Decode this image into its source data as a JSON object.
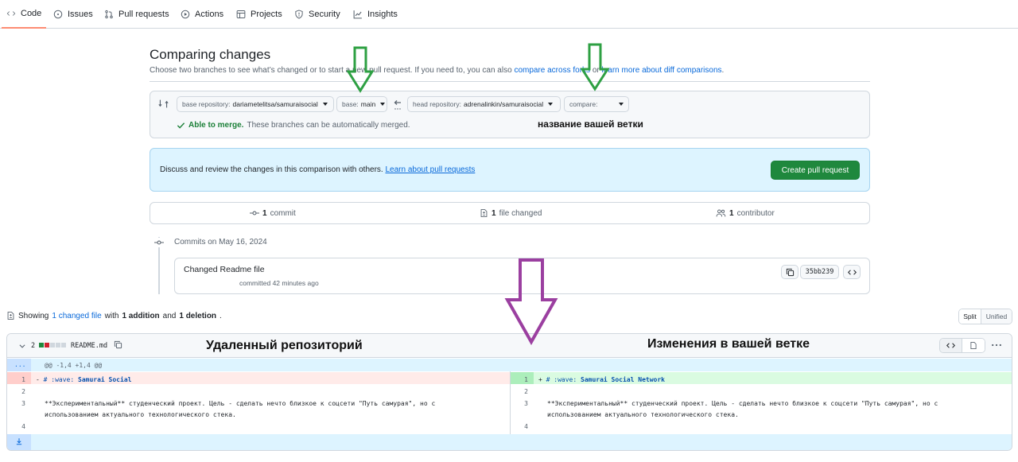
{
  "nav": {
    "tabs": [
      {
        "label": "Code",
        "icon": "code-icon"
      },
      {
        "label": "Issues",
        "icon": "issue-icon"
      },
      {
        "label": "Pull requests",
        "icon": "pull-request-icon"
      },
      {
        "label": "Actions",
        "icon": "play-icon"
      },
      {
        "label": "Projects",
        "icon": "table-icon"
      },
      {
        "label": "Security",
        "icon": "shield-icon"
      },
      {
        "label": "Insights",
        "icon": "graph-icon"
      }
    ]
  },
  "compare": {
    "title": "Comparing changes",
    "subtitle_pre": "Choose two branches to see what’s changed or to start a new pull request. If you need to, you can also",
    "subtitle_link1": "compare across forks",
    "subtitle_or": "or",
    "subtitle_link2": "learn more about diff comparisons",
    "subtitle_end": ".",
    "base_repo_label": "base repository:",
    "base_repo": "dariametelitsa/samuraisocial",
    "base_label": "base:",
    "base": "main",
    "head_repo_label": "head repository:",
    "head_repo": "adrenalinkin/samuraisocial",
    "compare_label": "compare:",
    "compare_value": "",
    "merge_status": "Able to merge.",
    "merge_desc": "These branches can be automatically merged."
  },
  "annotations": {
    "branch_name_note": "название вашей ветки",
    "remote_label": "Удаленный репозиторий",
    "changes_label": "Изменения в вашей ветке",
    "arrow_color_green": "#2ea043",
    "arrow_color_purple": "#9b3fa0"
  },
  "discuss": {
    "text": "Discuss and review the changes in this comparison with others.",
    "link": "Learn about pull requests",
    "button": "Create pull request"
  },
  "stats": {
    "commits_num": "1",
    "commits_label": "commit",
    "files_num": "1",
    "files_label": "file changed",
    "contributors_num": "1",
    "contributors_label": "contributor"
  },
  "commits": {
    "date_heading": "Commits on May 16, 2024",
    "message": "Changed Readme file",
    "meta": "committed 42 minutes ago",
    "sha": "35bb239"
  },
  "summary": {
    "showing": "Showing",
    "changed_files": "1 changed file",
    "with": "with",
    "additions": "1 addition",
    "and": "and",
    "deletions": "1 deletion",
    "end": ".",
    "view_split": "Split",
    "view_unified": "Unified"
  },
  "diff": {
    "count": "2",
    "filename": "README.md",
    "hunk": "@@ -1,4 +1,4 @@",
    "expand_top": "...",
    "left": [
      {
        "num": "1",
        "sign": "-",
        "text_md": "# :wave: ",
        "text_title": "Samurai Social",
        "type": "del"
      },
      {
        "num": "2",
        "sign": "",
        "text": "",
        "type": "ctx"
      },
      {
        "num": "3",
        "sign": "",
        "text": "**Экспериментальный** студенческий проект. Цель - сделать нечто близкое к соцсети \"Путь самурая\", но с",
        "type": "ctx"
      },
      {
        "num": "",
        "sign": "",
        "text": "использованием актуального технологического стека.",
        "type": "ctx"
      },
      {
        "num": "4",
        "sign": "",
        "text": "",
        "type": "ctx"
      }
    ],
    "right": [
      {
        "num": "1",
        "sign": "+",
        "text_md": "# :wave: ",
        "text_title": "Samurai Social Network",
        "type": "add"
      },
      {
        "num": "2",
        "sign": "",
        "text": "",
        "type": "ctx"
      },
      {
        "num": "3",
        "sign": "",
        "text": "**Экспериментальный** студенческий проект. Цель - сделать нечто близкое к соцсети \"Путь самурая\", но с",
        "type": "ctx"
      },
      {
        "num": "",
        "sign": "",
        "text": "использованием актуального технологического стека.",
        "type": "ctx"
      },
      {
        "num": "4",
        "sign": "",
        "text": "",
        "type": "ctx"
      }
    ]
  }
}
